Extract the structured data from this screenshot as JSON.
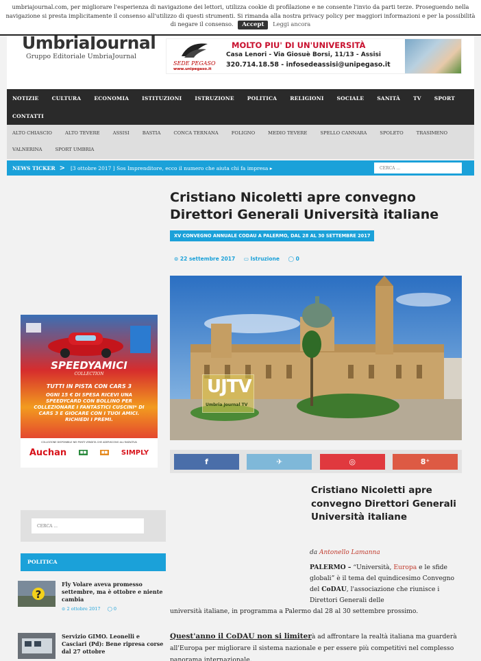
{
  "cookie": {
    "text": "umbriajournal.com, per migliorare l'esperienza di navigazione dei lettori, utilizza cookie di profilazione e ne consente l'invio da parti terze. Proseguendo nella navigazione si presta implicitamente il consenso all'utilizzo di questi strumenti. Si rimanda alla nostra privacy policy per maggiori informazioni e per la possibilità di negare il consenso.",
    "accept": "Accept",
    "more": "Leggi ancora"
  },
  "header": {
    "logo_title": "UmbriaJournal",
    "logo_sub": "Gruppo Editoriale UmbriaJournal"
  },
  "banner": {
    "line1": "MOLTO PIU' DI UN'UNIVERSITÀ",
    "line2": "Casa Lenori - Via Giosuè Borsi, 11/13 - Assisi",
    "line3": "320.714.18.58 - infosedeassisi@unipegaso.it",
    "sede": "SEDE PEGASO",
    "web": "www.unipegaso.it"
  },
  "nav": {
    "row1": [
      "NOTIZIE",
      "CULTURA",
      "ECONOMIA",
      "ISTITUZIONI",
      "ISTRUZIONE",
      "POLITICA",
      "RELIGIONI",
      "SOCIALE",
      "SANITÀ",
      "TV",
      "SPORT"
    ],
    "row2": [
      "CONTATTI"
    ]
  },
  "subnav": {
    "row1": [
      "ALTO CHIASCIO",
      "ALTO TEVERE",
      "ASSISI",
      "BASTIA",
      "CONCA TERNANA",
      "FOLIGNO",
      "MEDIO TEVERE",
      "SPELLO CANNARA",
      "SPOLETO",
      "TRASIMENO"
    ],
    "row2": [
      "VALNERINA",
      "SPORT UMBRIA"
    ]
  },
  "ticker": {
    "label": "NEWS TICKER",
    "arrow": ">",
    "text": "[3 ottobre 2017 ] Sos Imprenditore, ecco il numero che aiuta chi fa impresa ▸",
    "search_placeholder": "CERCA ..."
  },
  "ad": {
    "title": "SPEEDYAMICI",
    "sub": "COLLECTION",
    "line1": "TUTTI IN PISTA CON CARS 3",
    "line2": "OGNI 15 € DI SPESA RICEVI UNA SPEEDYCARD CON BOLLINO PER COLLEZIONARE I FANTASTICI CUSCINI* DI CARS 3 E GIOCARE CON I TUOI AMICI. RICHIEDI I PREMI.",
    "small": "COLLEZIONE DISPONIBILE NEI PUNTI VENDITA CHE ADERISCONO ALL'INIZIATIVA",
    "auchan": "Auchan",
    "simply": "SIMPLY"
  },
  "sidebar": {
    "search_placeholder": "CERCA ...",
    "section_title": "POLITICA",
    "posts": [
      {
        "title": "Fly Volare aveva promesso settembre, ma è ottobre e niente cambia",
        "date": "⊙ 2 ottobre 2017",
        "comments": "◯ 0"
      },
      {
        "title": "Servizio GIMO. Leonelli e Casciari (Pd): Bene ripresa corse dal 27 ottobre",
        "date": "",
        "comments": ""
      }
    ]
  },
  "article": {
    "title": "Cristiano Nicoletti apre convegno Direttori Generali Università italiane",
    "tag": "XV CONVEGNO ANNUALE CODAU A PALERMO, DAL 28 AL 30 SETTEMBRE 2017",
    "date": "⊙ 22 settembre 2017",
    "category": "▭ Istruzione",
    "comments": "◯ 0",
    "image_logo_big": "UJTV",
    "image_logo_small": "Umbria Journal TV",
    "share": {
      "facebook": "f",
      "twitter": "🐦",
      "pinterest": "℗",
      "gplus": "8⁺"
    },
    "h2": "Cristiano Nicoletti apre convegno Direttori Generali Università italiane",
    "byline_prefix": "da",
    "author": "Antonello Lamanna",
    "p1_lead": "PALERMO –",
    "p1_a": "“Università,",
    "p1_red": "Europa",
    "p1_b": "e le sfide globali” è il tema del quindicesimo Convegno del",
    "p1_codau": "CoDAU",
    "p1_c": ", l'associazione che riunisce i Direttori Generali delle",
    "p1_cont": "università italiane, in programma a Palermo dal 28 al 30 settembre prossimo.",
    "p2_lead": "Quest'anno il CoDAU non si limiter",
    "p2_text": "à ad affrontare la realtà italiana ma guarderà all'Europa per migliorare il sistema nazionale e per essere più competitivi nel complesso panorama internazionale."
  },
  "colors": {
    "accent": "#1ba1d9",
    "nav_bg": "#2a2a2a",
    "facebook": "#4a6ea9",
    "twitter": "#7fb8d9",
    "pinterest": "#e0393e",
    "gplus": "#dd5a44"
  }
}
